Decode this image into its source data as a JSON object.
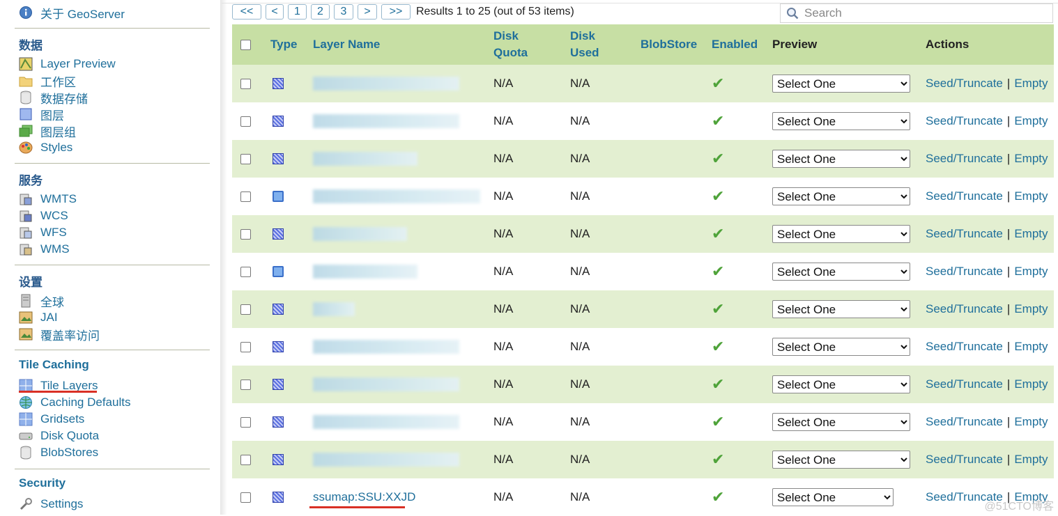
{
  "sidebar": {
    "about": "关于 GeoServer",
    "sections": [
      {
        "title": "数据",
        "items": [
          "Layer Preview",
          "工作区",
          "数据存储",
          "图层",
          "图层组",
          "Styles"
        ]
      },
      {
        "title": "服务",
        "items": [
          "WMTS",
          "WCS",
          "WFS",
          "WMS"
        ]
      },
      {
        "title": "设置",
        "items": [
          "全球",
          "JAI",
          "覆盖率访问"
        ]
      },
      {
        "title": "Tile Caching",
        "items": [
          "Tile Layers",
          "Caching Defaults",
          "Gridsets",
          "Disk Quota",
          "BlobStores"
        ]
      },
      {
        "title": "Security",
        "items": [
          "Settings"
        ]
      }
    ]
  },
  "pager": {
    "first": "<<",
    "prev": "<",
    "pages": [
      "1",
      "2",
      "3"
    ],
    "next": ">",
    "last": ">>",
    "results": "Results 1 to 25 (out of 53 items)"
  },
  "search": {
    "placeholder": "Search"
  },
  "table": {
    "headers": {
      "type": "Type",
      "layer_name": "Layer Name",
      "disk_quota": "Disk Quota",
      "disk_used": "Disk Used",
      "blobstore": "BlobStore",
      "enabled": "Enabled",
      "preview": "Preview",
      "actions": "Actions"
    },
    "select_label": "Select One",
    "seed_label": "Seed/Truncate",
    "empty_label": "Empty",
    "separator": "|",
    "rows": [
      {
        "type": "grid",
        "name": "",
        "disk_quota": "N/A",
        "disk_used": "N/A",
        "enabled": true
      },
      {
        "type": "grid",
        "name": "",
        "disk_quota": "N/A",
        "disk_used": "N/A",
        "enabled": true
      },
      {
        "type": "grid",
        "name": "",
        "disk_quota": "N/A",
        "disk_used": "N/A",
        "enabled": true
      },
      {
        "type": "polygon",
        "name": "",
        "disk_quota": "N/A",
        "disk_used": "N/A",
        "enabled": true
      },
      {
        "type": "grid",
        "name": "",
        "disk_quota": "N/A",
        "disk_used": "N/A",
        "enabled": true
      },
      {
        "type": "polygon",
        "name": "",
        "disk_quota": "N/A",
        "disk_used": "N/A",
        "enabled": true
      },
      {
        "type": "grid",
        "name": "",
        "disk_quota": "N/A",
        "disk_used": "N/A",
        "enabled": true
      },
      {
        "type": "grid",
        "name": "",
        "disk_quota": "N/A",
        "disk_used": "N/A",
        "enabled": true
      },
      {
        "type": "grid",
        "name": "",
        "disk_quota": "N/A",
        "disk_used": "N/A",
        "enabled": true
      },
      {
        "type": "grid",
        "name": "",
        "disk_quota": "N/A",
        "disk_used": "N/A",
        "enabled": true
      },
      {
        "type": "grid",
        "name": "",
        "disk_quota": "N/A",
        "disk_used": "N/A",
        "enabled": true
      },
      {
        "type": "grid",
        "name": "ssumap:SSU:XXJD",
        "disk_quota": "N/A",
        "disk_used": "N/A",
        "enabled": true
      }
    ]
  },
  "watermark": "@51CTO博客"
}
